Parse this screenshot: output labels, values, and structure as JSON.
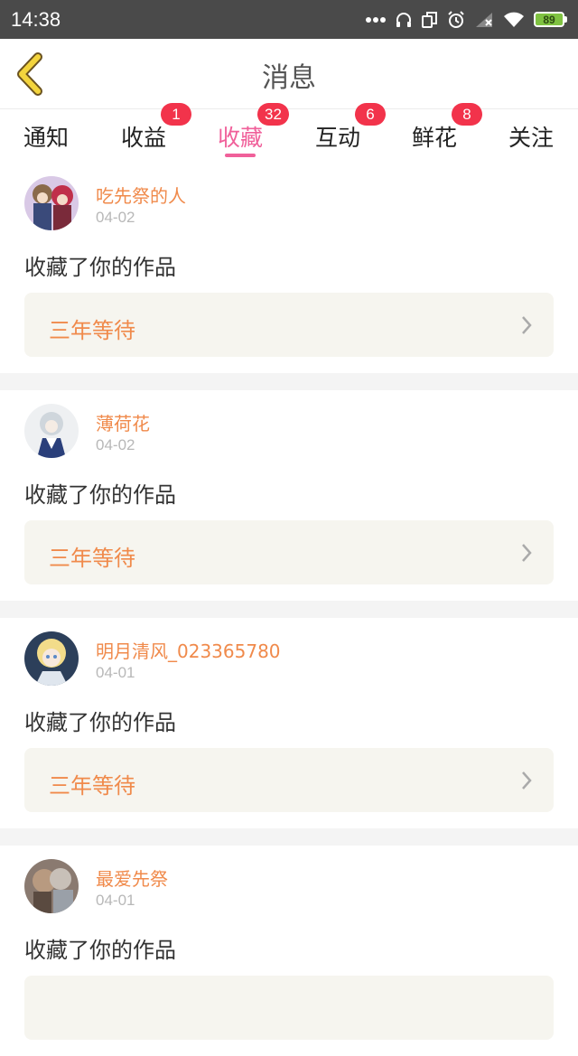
{
  "status_bar": {
    "time": "14:38",
    "battery": "89"
  },
  "nav": {
    "title": "消息"
  },
  "tabs": [
    {
      "label": "通知"
    },
    {
      "label": "收益",
      "badge": "1"
    },
    {
      "label": "收藏",
      "badge": "32"
    },
    {
      "label": "互动",
      "badge": "6"
    },
    {
      "label": "鲜花",
      "badge": "8"
    },
    {
      "label": "关注"
    }
  ],
  "colors": {
    "accent_pink": "#f0609a",
    "username_orange": "#f08a4b",
    "badge_red": "#f2334b",
    "status_bar": "#4a4a4a"
  },
  "feed": [
    {
      "username": "吃先祭的人",
      "date": "04-02",
      "action": "收藏了你的作品",
      "work_title": "三年等待"
    },
    {
      "username": "薄荷花",
      "date": "04-02",
      "action": "收藏了你的作品",
      "work_title": "三年等待"
    },
    {
      "username": "明月清风_023365780",
      "date": "04-01",
      "action": "收藏了你的作品",
      "work_title": "三年等待"
    },
    {
      "username": "最爱先祭",
      "date": "04-01",
      "action": "收藏了你的作品",
      "work_title": ""
    }
  ]
}
